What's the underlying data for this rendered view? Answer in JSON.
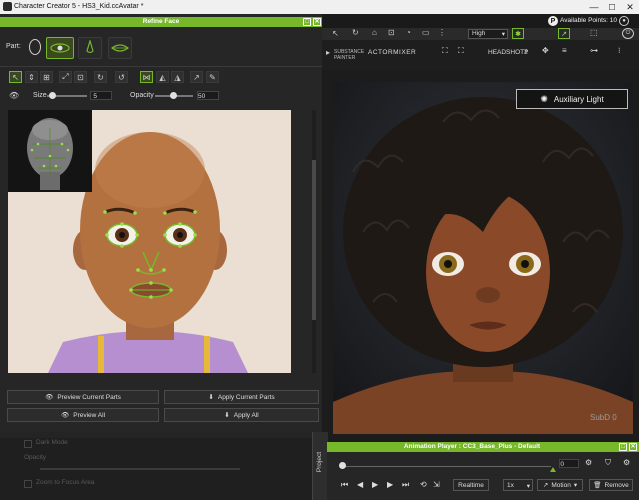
{
  "window": {
    "title": "Character Creator 5 - HS3_Kid.ccAvatar *",
    "minimize": "—",
    "maximize": "☐",
    "close": "✕"
  },
  "account": {
    "available_points": "Available Points: 10"
  },
  "refine_face": {
    "title": "Refine Face",
    "part_label": "Part:",
    "size_label": "Size",
    "size_value": "5",
    "opacity_label": "Opacity",
    "opacity_value": "50",
    "preview_current": "Preview Current Parts",
    "apply_current": "Apply Current Parts",
    "preview_all": "Preview All",
    "apply_all": "Apply All"
  },
  "faded_panel": {
    "items": [
      "Dark Mode",
      "Opacity",
      "Zoom to Focus Area"
    ]
  },
  "toolbar": {
    "quality": "High",
    "substance": "SUBSTANCE PAINTER",
    "actormixer": "ACTORMIXER",
    "headshot": "HEADSHOT2"
  },
  "viewport": {
    "aux_light": "Auxiliary Light",
    "subd": "SubD 0"
  },
  "project_tab": "Project",
  "animation_player": {
    "title": "Animation Player : CC3_Base_Plus - Default",
    "frame": "0",
    "realtime": "Realtime",
    "speed": "1x",
    "motion": "Motion",
    "remove": "Remove"
  },
  "colors": {
    "accent": "#76b82a"
  }
}
